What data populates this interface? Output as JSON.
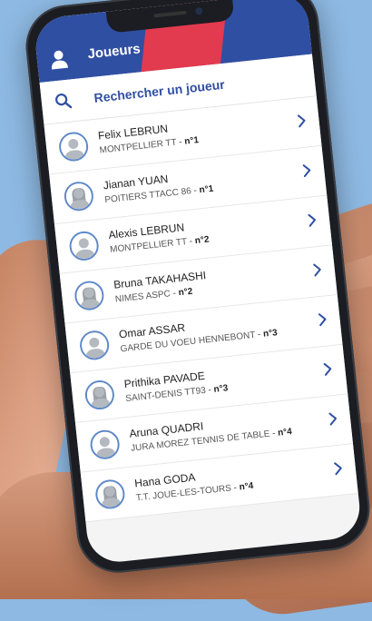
{
  "colors": {
    "primary_blue": "#2f4fa3",
    "accent_red": "#e23a4e",
    "avatar_ring": "#5e88c8",
    "background": "#8eb9e2"
  },
  "header": {
    "title": "Joueurs",
    "user_icon": "user-icon"
  },
  "search": {
    "icon": "search-icon",
    "label": "Rechercher un joueur"
  },
  "players": [
    {
      "name": "Felix LEBRUN",
      "club": "MONTPELLIER TT",
      "separator": "-",
      "rank": "n°1",
      "avatar": "male-avatar-icon"
    },
    {
      "name": "Jianan YUAN",
      "club": "POITIERS TTACC 86",
      "separator": "-",
      "rank": "n°1",
      "avatar": "female-avatar-icon"
    },
    {
      "name": "Alexis LEBRUN",
      "club": "MONTPELLIER TT",
      "separator": "-",
      "rank": "n°2",
      "avatar": "male-avatar-icon"
    },
    {
      "name": "Bruna TAKAHASHI",
      "club": "NIMES ASPC",
      "separator": "-",
      "rank": "n°2",
      "avatar": "female-avatar-icon"
    },
    {
      "name": "Omar ASSAR",
      "club": "GARDE DU VOEU HENNEBONT",
      "separator": "-",
      "rank": "n°3",
      "avatar": "male-avatar-icon"
    },
    {
      "name": "Prithika PAVADE",
      "club": "SAINT-DENIS TT93",
      "separator": "-",
      "rank": "n°3",
      "avatar": "female-avatar-icon"
    },
    {
      "name": "Aruna QUADRI",
      "club": "JURA MOREZ TENNIS DE TABLE",
      "separator": "-",
      "rank": "n°4",
      "avatar": "male-avatar-icon"
    },
    {
      "name": "Hana GODA",
      "club": "T.T. JOUE-LES-TOURS",
      "separator": "-",
      "rank": "n°4",
      "avatar": "female-avatar-icon"
    }
  ]
}
